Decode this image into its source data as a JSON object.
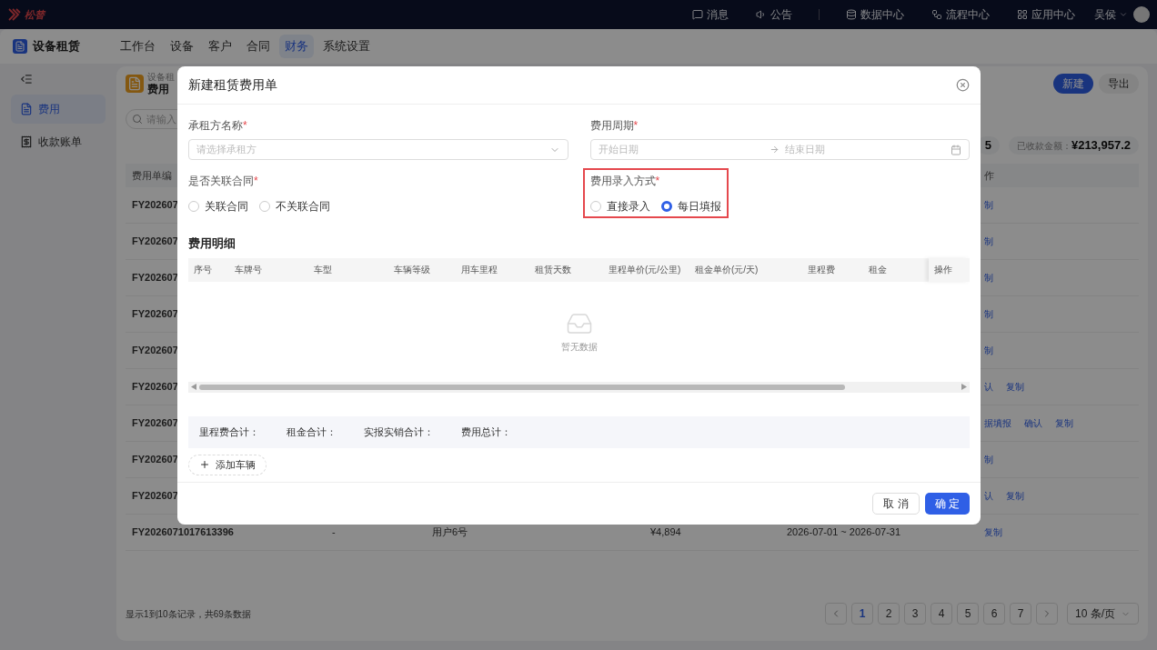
{
  "topbar": {
    "logo": "松替",
    "items": [
      {
        "label": "消息"
      },
      {
        "label": "公告"
      },
      {
        "label": "数据中心"
      },
      {
        "label": "流程中心"
      },
      {
        "label": "应用中心"
      }
    ],
    "user": "吴侯"
  },
  "app": {
    "title": "设备租赁",
    "tabs": [
      {
        "label": "工作台",
        "selected": false
      },
      {
        "label": "设备",
        "selected": false
      },
      {
        "label": "客户",
        "selected": false
      },
      {
        "label": "合同",
        "selected": false
      },
      {
        "label": "财务",
        "selected": true
      },
      {
        "label": "系统设置",
        "selected": false
      }
    ]
  },
  "sidebar": {
    "items": [
      {
        "label": "费用",
        "selected": true
      },
      {
        "label": "收款账单",
        "selected": false
      }
    ]
  },
  "page": {
    "breadcrumb": "设备租",
    "title": "费用",
    "buttons": [
      "新建",
      "导出"
    ],
    "search": {
      "placeholder": "请输入"
    },
    "stats": [
      {
        "value": "5"
      },
      {
        "label": "已收款金额：",
        "value": "¥213,957.2"
      }
    ],
    "table": {
      "columns": [
        "费用单编",
        "作"
      ],
      "rows": [
        {
          "cells": [
            "FY202607"
          ],
          "actions": [
            "制"
          ]
        },
        {
          "cells": [
            "FY202607"
          ],
          "actions": [
            "制"
          ]
        },
        {
          "cells": [
            "FY202607"
          ],
          "actions": [
            "制"
          ]
        },
        {
          "cells": [
            "FY202607"
          ],
          "actions": [
            "制"
          ]
        },
        {
          "cells": [
            "FY202607"
          ],
          "actions": [
            "制"
          ]
        },
        {
          "cells": [
            "FY202607"
          ],
          "actions": [
            "认",
            "复制"
          ]
        },
        {
          "cells": [
            "FY202607"
          ],
          "actions": [
            "据填报",
            "确认",
            "复制"
          ]
        },
        {
          "cells": [
            "FY202607"
          ],
          "actions": [
            "制"
          ]
        },
        {
          "cells": [
            "FY202607"
          ],
          "actions": [
            "认",
            "复制"
          ]
        },
        {
          "cells": [
            "FY2026071017613396",
            "-",
            "用户6号",
            "¥4,894",
            "2026-07-01 ~ 2026-07-31"
          ],
          "actions": [
            "复制"
          ]
        }
      ]
    },
    "pagination": {
      "summary": "显示1到10条记录，共69条数据",
      "pages": [
        {
          "label": "1",
          "selected": true
        },
        {
          "label": "2",
          "selected": false
        },
        {
          "label": "3",
          "selected": false
        },
        {
          "label": "4",
          "selected": false
        },
        {
          "label": "5",
          "selected": false
        },
        {
          "label": "6",
          "selected": false
        },
        {
          "label": "7",
          "selected": false
        }
      ],
      "page_size": "10 条/页"
    }
  },
  "dialog": {
    "title": "新建租赁费用单",
    "tenant": {
      "label": "承租方名称",
      "required_mark": "*",
      "placeholder": "请选择承租方"
    },
    "period": {
      "label": "费用周期",
      "required_mark": "*",
      "start_placeholder": "开始日期",
      "end_placeholder": "结束日期"
    },
    "contract": {
      "label": "是否关联合同",
      "required_mark": "*",
      "options": [
        {
          "label": "关联合同",
          "selected": false
        },
        {
          "label": "不关联合同",
          "selected": false
        }
      ]
    },
    "entry_mode": {
      "label": "费用录入方式",
      "required_mark": "*",
      "highlighted": true,
      "options": [
        {
          "label": "直接录入",
          "selected": false
        },
        {
          "label": "每日填报",
          "selected": true
        }
      ]
    },
    "detail": {
      "title": "费用明细",
      "columns": [
        "序号",
        "车牌号",
        "车型",
        "车辆等级",
        "用车里程",
        "租赁天数",
        "里程单价(元/公里)",
        "租金单价(元/天)",
        "里程费",
        "租金"
      ],
      "action_column": "操作",
      "empty_text": "暂无数据"
    },
    "totals": [
      "里程费合计：",
      "租金合计：",
      "实报实销合计：",
      "费用总计："
    ],
    "add_button": "添加车辆",
    "buttons": [
      {
        "label": "取 消",
        "kind": "secondary"
      },
      {
        "label": "确 定",
        "kind": "primary"
      }
    ]
  }
}
